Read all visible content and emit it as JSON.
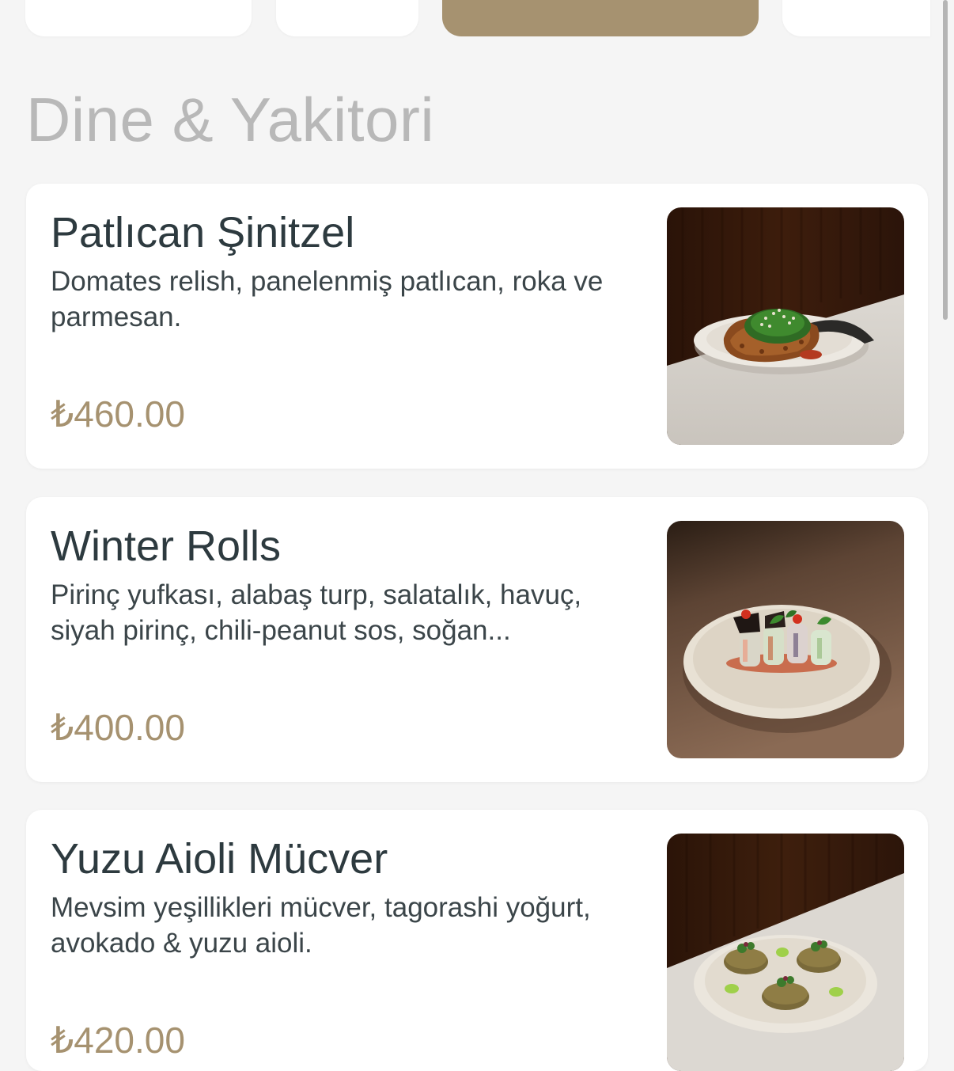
{
  "section": {
    "title": "Dine & Yakitori"
  },
  "colors": {
    "accent": "#a69270",
    "background": "#f5f5f5",
    "card": "#ffffff",
    "title_text": "#2d3a3f",
    "section_title": "#b8b8b8"
  },
  "items": [
    {
      "name": "Patlıcan Şinitzel",
      "description": "Domates relish, panelenmiş patlıcan, roka ve parmesan.",
      "price": "₺460.00",
      "image": "schnitzel-dish-photo"
    },
    {
      "name": "Winter Rolls",
      "description": "Pirinç yufkası, alabaş turp, salatalık, havuç, siyah pirinç, chili-peanut sos, soğan...",
      "price": "₺400.00",
      "image": "winter-rolls-dish-photo"
    },
    {
      "name": "Yuzu Aioli Mücver",
      "description": "Mevsim yeşillikleri mücver, tagorashi yoğurt, avokado & yuzu aioli.",
      "price": "₺420.00",
      "image": "mucver-dish-photo"
    }
  ]
}
